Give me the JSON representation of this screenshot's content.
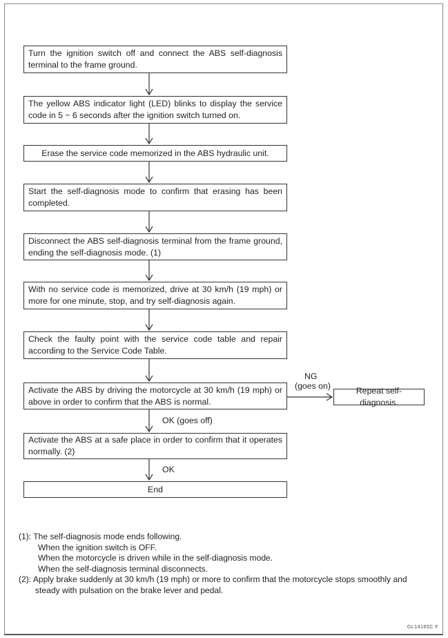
{
  "steps": [
    {
      "text": "Turn the ignition switch off and connect the ABS self-diagnosis terminal to the frame ground."
    },
    {
      "text": "The yellow ABS indicator light (LED) blinks to display the service code in 5 ~ 6 seconds after the ignition switch turned on."
    },
    {
      "text": "Erase the service code memorized in the ABS hydraulic unit."
    },
    {
      "text": "Start the self-diagnosis mode to confirm that erasing has been completed."
    },
    {
      "text": "Disconnect the ABS self-diagnosis terminal from the frame ground, ending the self-diagnosis mode. (1)"
    },
    {
      "text": "With no service code is memorized, drive at 30 km/h (19 mph) or more for one minute, stop, and try self-diagnosis again."
    },
    {
      "text": "Check the faulty point with the service code table and repair according to the Service Code Table."
    },
    {
      "text": "Activate the ABS by driving the motorcycle at 30 km/h (19 mph) or above in order to confirm that the ABS is normal."
    },
    {
      "text": "Activate the ABS at a safe place in order to confirm that it operates normally. (2)"
    },
    {
      "text": "End"
    }
  ],
  "branch": {
    "ng_label": "NG",
    "ng_sub": "(goes on)",
    "ng_target": "Repeat self-diagnosis."
  },
  "ok_labels": [
    "OK (goes off)",
    "OK"
  ],
  "notes": {
    "n1_marker": "(1):",
    "n1_lines": [
      "The self-diagnosis mode ends following.",
      "When the ignition switch is OFF.",
      "When the motorcycle is driven while in the self-diagnosis mode.",
      "When the self-diagnosis terminal disconnects."
    ],
    "n2_marker": "(2):",
    "n2_lines": [
      "Apply brake suddenly at 30 km/h (19 mph) or more to confirm that the motorcycle stops smoothly and",
      "steady with pulsation on the brake lever and pedal."
    ]
  },
  "figure_code": "GL14165C  F"
}
